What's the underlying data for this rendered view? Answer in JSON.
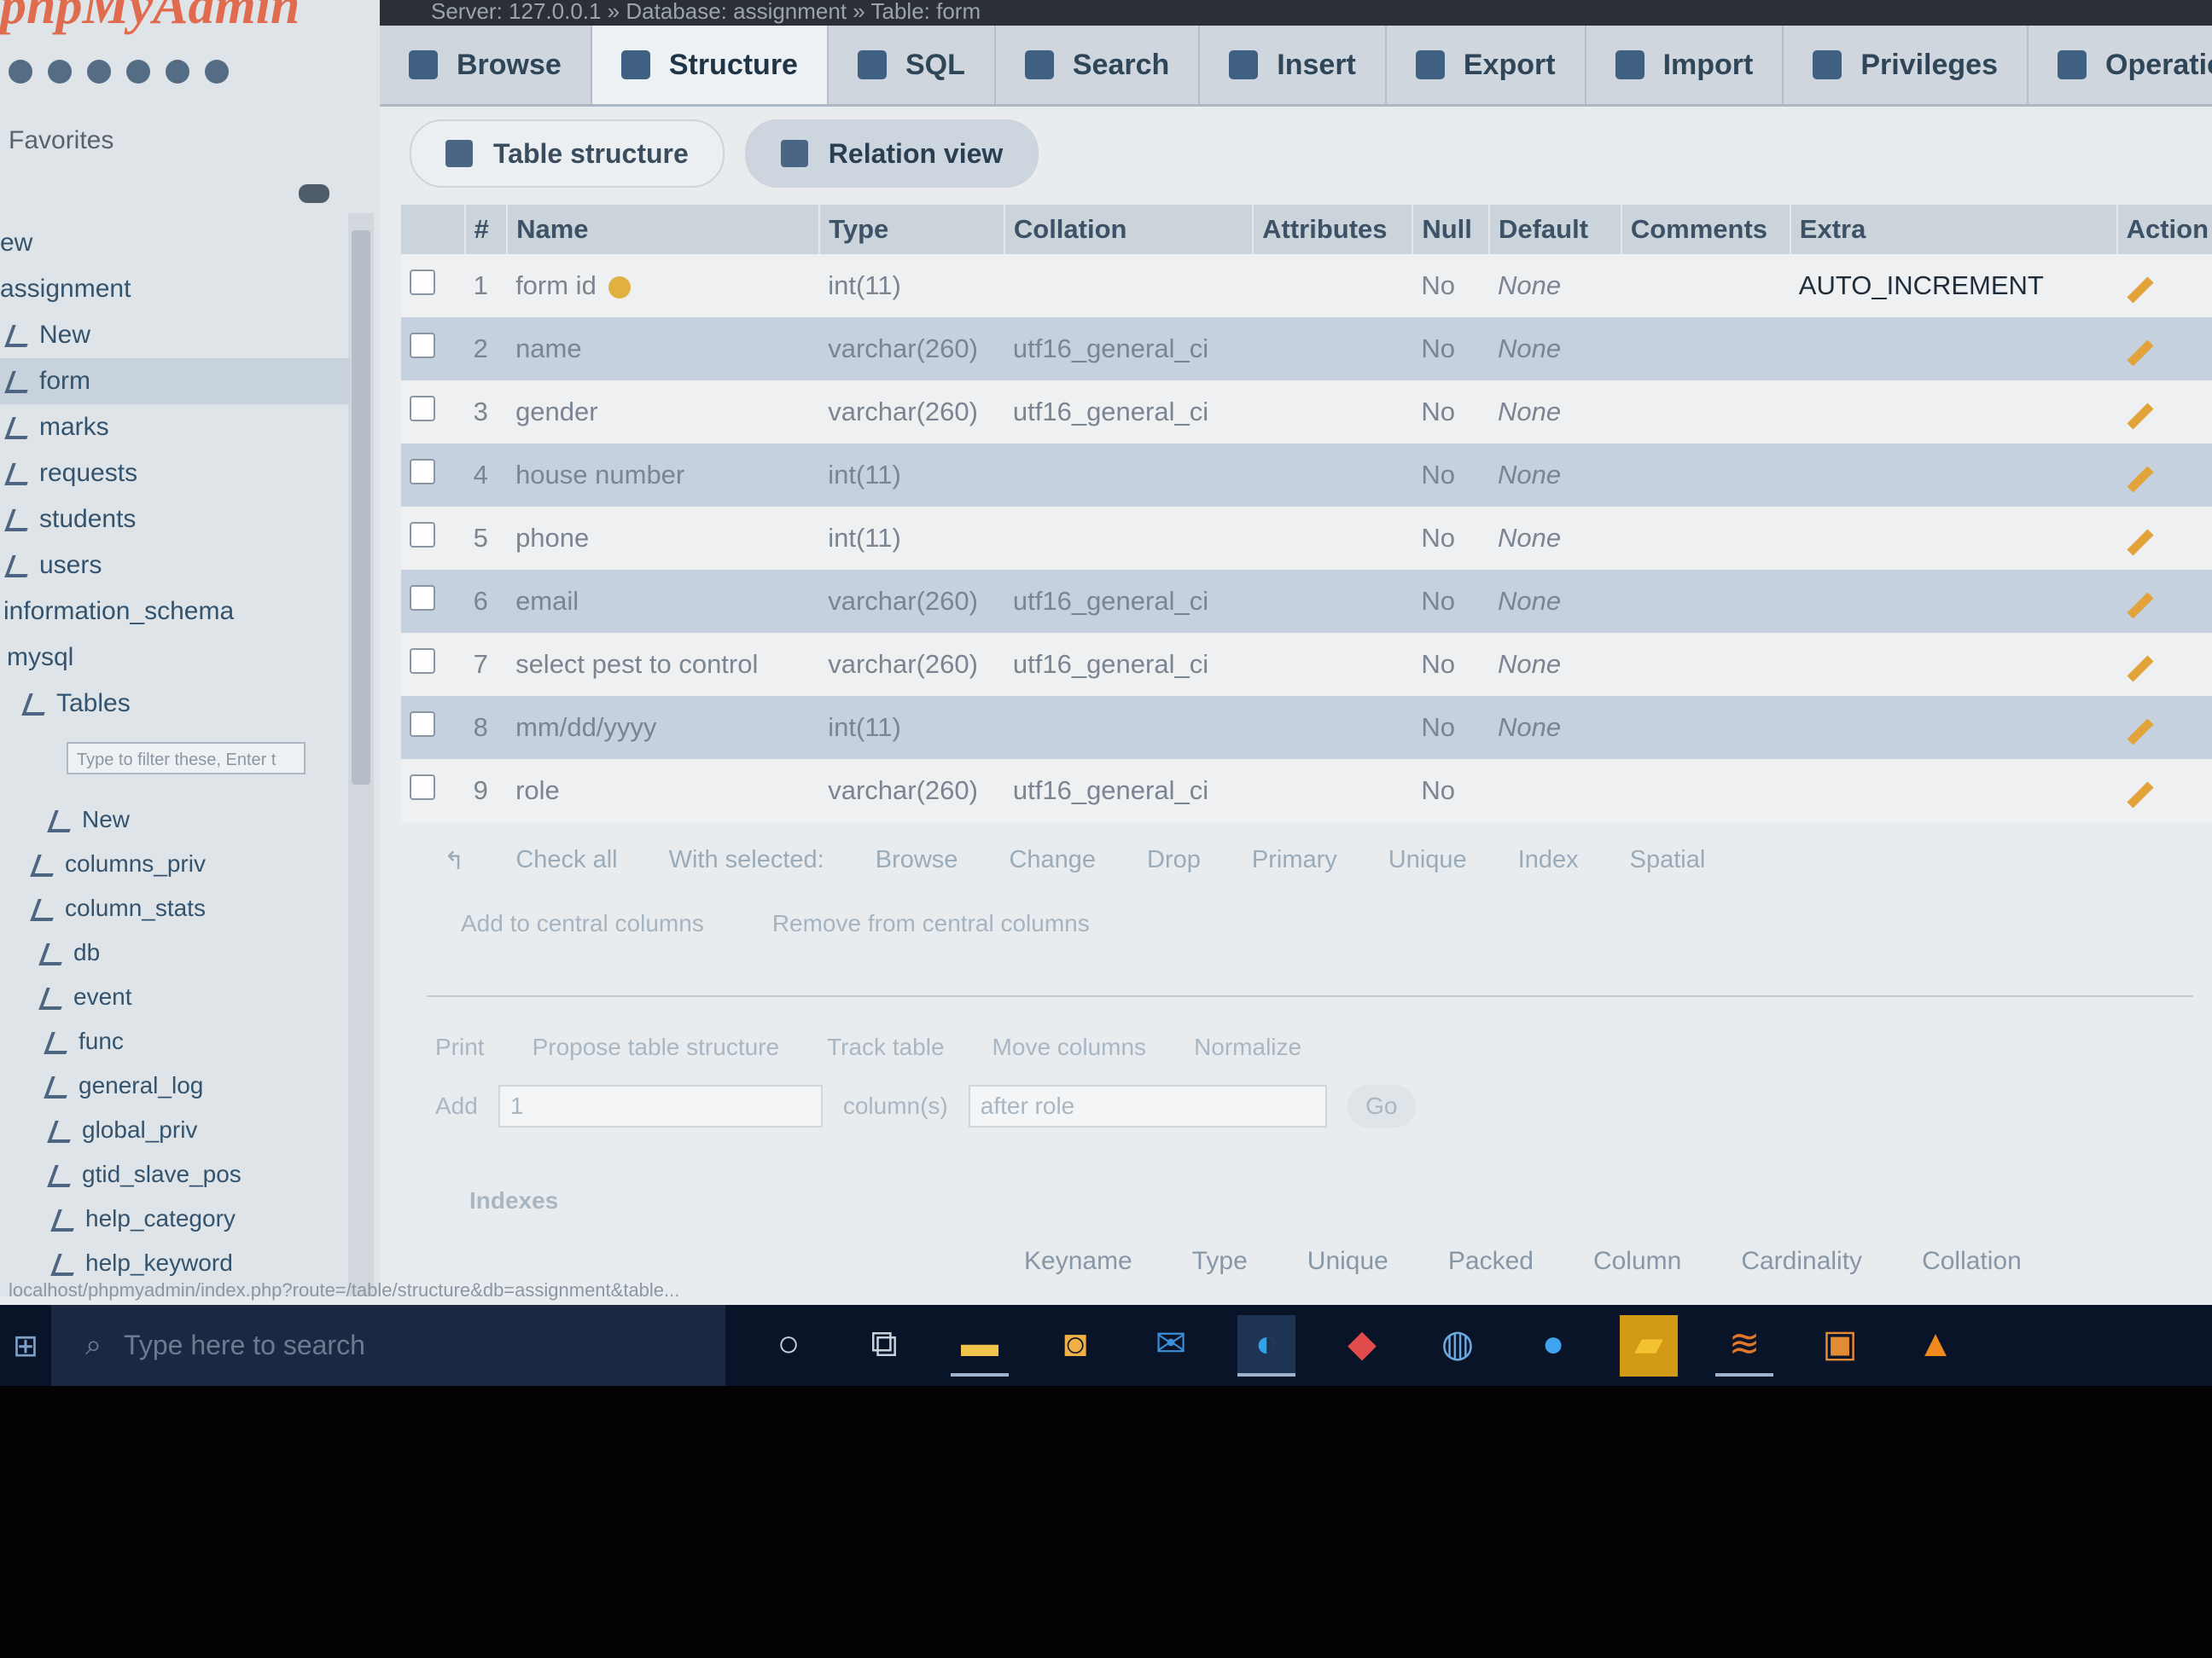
{
  "window_title": "Server: 127.0.0.1 » Database: assignment » Table: form",
  "sidebar": {
    "logo": "phpMyAdmin",
    "favorites_label": "Favorites",
    "items": [
      {
        "label": "ew"
      },
      {
        "label": "assignment"
      },
      {
        "label": "New"
      },
      {
        "label": "form"
      },
      {
        "label": "marks"
      },
      {
        "label": "requests"
      },
      {
        "label": "students"
      },
      {
        "label": "users"
      },
      {
        "label": "information_schema"
      },
      {
        "label": "mysql"
      },
      {
        "label": "Tables"
      }
    ],
    "filter_placeholder": "Type to filter these, Enter t",
    "mysql_items": [
      {
        "label": "New"
      },
      {
        "label": "columns_priv"
      },
      {
        "label": "column_stats"
      },
      {
        "label": "db"
      },
      {
        "label": "event"
      },
      {
        "label": "func"
      },
      {
        "label": "general_log"
      },
      {
        "label": "global_priv"
      },
      {
        "label": "gtid_slave_pos"
      },
      {
        "label": "help_category"
      },
      {
        "label": "help_keyword"
      }
    ]
  },
  "tabs": [
    {
      "label": "Browse"
    },
    {
      "label": "Structure"
    },
    {
      "label": "SQL"
    },
    {
      "label": "Search"
    },
    {
      "label": "Insert"
    },
    {
      "label": "Export"
    },
    {
      "label": "Import"
    },
    {
      "label": "Privileges"
    },
    {
      "label": "Operations"
    }
  ],
  "subtabs": {
    "table_structure": "Table structure",
    "relation_view": "Relation view"
  },
  "table": {
    "headers": {
      "num": "#",
      "name": "Name",
      "type": "Type",
      "collation": "Collation",
      "attributes": "Attributes",
      "null": "Null",
      "default": "Default",
      "comments": "Comments",
      "extra": "Extra",
      "action": "Action"
    },
    "rows": [
      {
        "num": "1",
        "name": "form id",
        "type": "int(11)",
        "collation": "",
        "null": "No",
        "default": "None",
        "extra": "AUTO_INCREMENT"
      },
      {
        "num": "2",
        "name": "name",
        "type": "varchar(260)",
        "collation": "utf16_general_ci",
        "null": "No",
        "default": "None",
        "extra": ""
      },
      {
        "num": "3",
        "name": "gender",
        "type": "varchar(260)",
        "collation": "utf16_general_ci",
        "null": "No",
        "default": "None",
        "extra": ""
      },
      {
        "num": "4",
        "name": "house number",
        "type": "int(11)",
        "collation": "",
        "null": "No",
        "default": "None",
        "extra": ""
      },
      {
        "num": "5",
        "name": "phone",
        "type": "int(11)",
        "collation": "",
        "null": "No",
        "default": "None",
        "extra": ""
      },
      {
        "num": "6",
        "name": "email",
        "type": "varchar(260)",
        "collation": "utf16_general_ci",
        "null": "No",
        "default": "None",
        "extra": ""
      },
      {
        "num": "7",
        "name": "select pest to control",
        "type": "varchar(260)",
        "collation": "utf16_general_ci",
        "null": "No",
        "default": "None",
        "extra": ""
      },
      {
        "num": "8",
        "name": "mm/dd/yyyy",
        "type": "int(11)",
        "collation": "",
        "null": "No",
        "default": "None",
        "extra": ""
      },
      {
        "num": "9",
        "name": "role",
        "type": "varchar(260)",
        "collation": "utf16_general_ci",
        "null": "No",
        "default": "",
        "extra": ""
      }
    ]
  },
  "bulk": {
    "check_all": "Check all",
    "with_selected": "With selected:",
    "browse": "Browse",
    "change": "Change",
    "drop": "Drop",
    "primary": "Primary",
    "unique": "Unique",
    "index": "Index",
    "spatial": "Spatial",
    "add_central": "Add to central columns",
    "remove_central": "Remove from central columns"
  },
  "tools": {
    "print": "Print",
    "propose": "Propose table structure",
    "track": "Track table",
    "move": "Move columns",
    "normalize": "Normalize"
  },
  "add_column": {
    "add": "Add",
    "count": "1",
    "columns": "column(s)",
    "position": "after role",
    "go": "Go"
  },
  "indexes": {
    "title": "Indexes",
    "headers": [
      "Keyname",
      "Type",
      "Unique",
      "Packed",
      "Column",
      "Cardinality",
      "Collation"
    ]
  },
  "status_url": "localhost/phpmyadmin/index.php?route=/table/structure&db=assignment&table...",
  "taskbar": {
    "search_placeholder": "Type here to search"
  }
}
